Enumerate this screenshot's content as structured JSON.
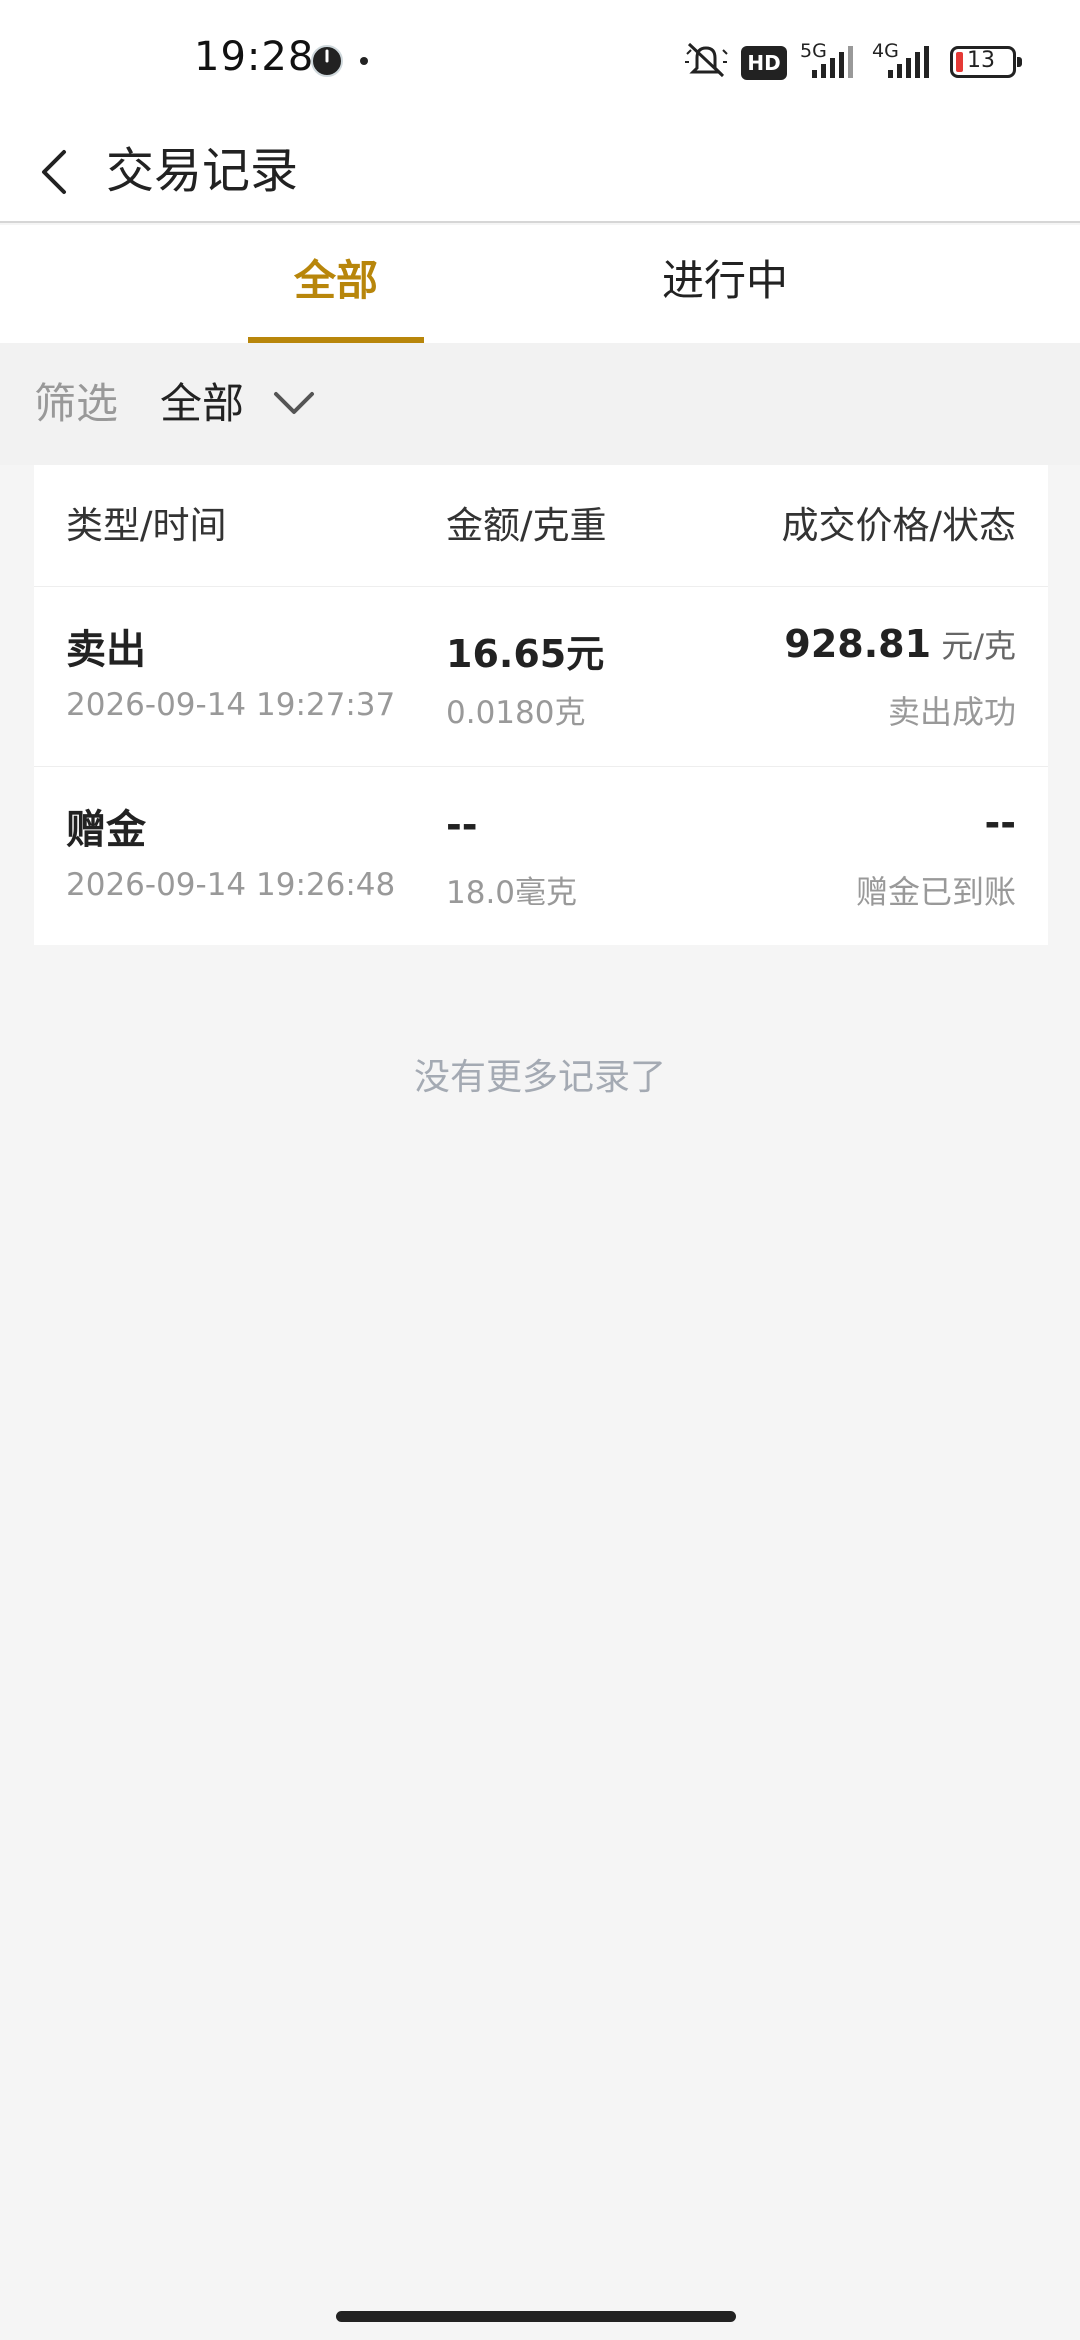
{
  "status_bar": {
    "time": "19:28",
    "hd": "HD",
    "net1": "5G",
    "net2": "4G",
    "battery": "13",
    "battery_color": "#e53935"
  },
  "header": {
    "back_icon": "chevron-left-icon",
    "title": "交易记录"
  },
  "tabs": [
    {
      "label": "全部",
      "active": true
    },
    {
      "label": "进行中",
      "active": false
    }
  ],
  "filter": {
    "label": "筛选",
    "value": "全部",
    "icon": "chevron-down-icon"
  },
  "table": {
    "columns": [
      "类型/时间",
      "金额/克重",
      "成交价格/状态"
    ],
    "rows": [
      {
        "type": "卖出",
        "time": "2026-09-14 19:27:37",
        "amount": "16.65元",
        "weight_num": "0.0180",
        "weight_unit": "克",
        "price_num": "928.81",
        "price_unit": " 元/克",
        "status": "卖出成功"
      },
      {
        "type": "赠金",
        "time": "2026-09-14 19:26:48",
        "amount": "--",
        "weight_num": "18.0",
        "weight_unit": "毫克",
        "price_num": "--",
        "price_unit": "",
        "status": "赠金已到账"
      }
    ]
  },
  "footer": {
    "no_more": "没有更多记录了"
  },
  "colors": {
    "accent": "#b8860b",
    "background": "#f5f5f5"
  }
}
